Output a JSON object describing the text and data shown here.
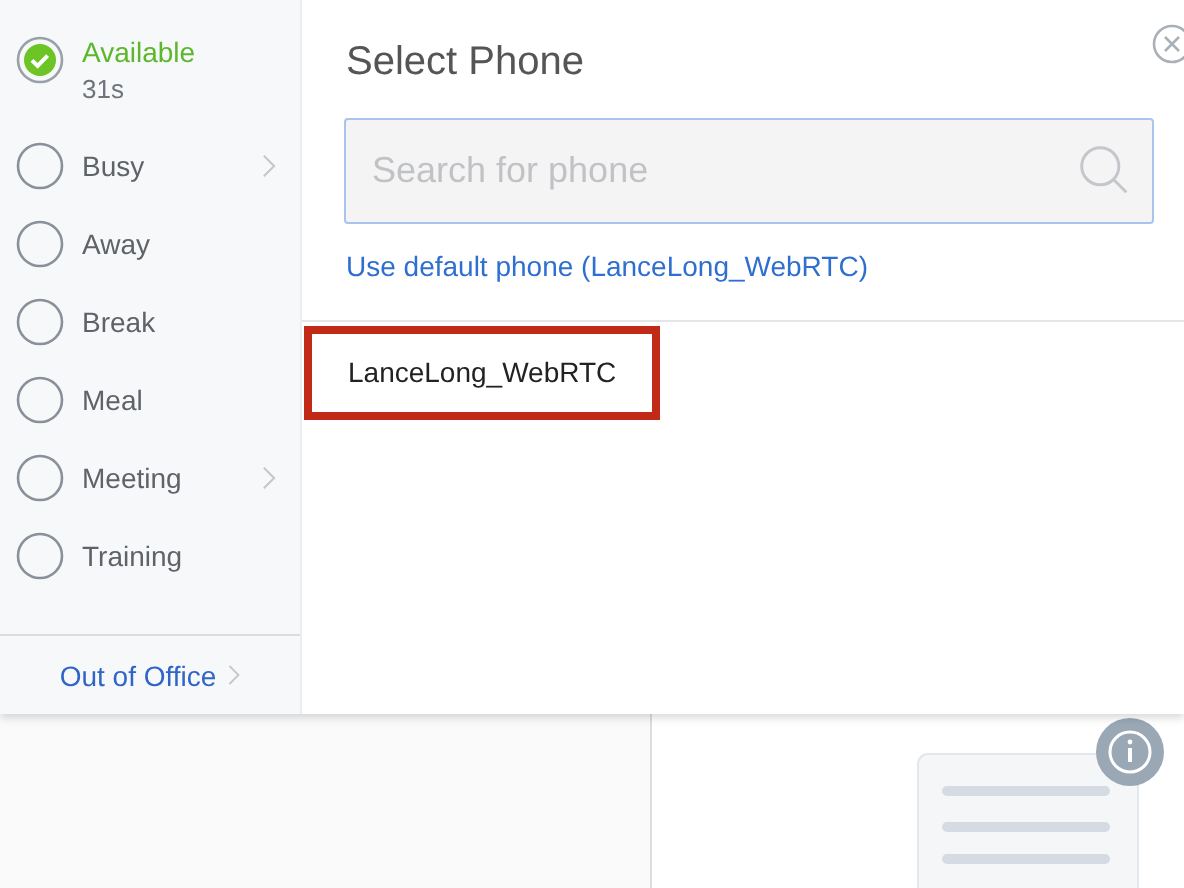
{
  "statuses": [
    {
      "label": "Available",
      "detail": "31s",
      "selected": true,
      "submenu": false
    },
    {
      "label": "Busy",
      "selected": false,
      "submenu": true
    },
    {
      "label": "Away",
      "selected": false,
      "submenu": false
    },
    {
      "label": "Break",
      "selected": false,
      "submenu": false
    },
    {
      "label": "Meal",
      "selected": false,
      "submenu": false
    },
    {
      "label": "Meeting",
      "selected": false,
      "submenu": true
    },
    {
      "label": "Training",
      "selected": false,
      "submenu": false
    }
  ],
  "out_of_office": {
    "label": "Out of Office"
  },
  "dialog": {
    "title": "Select Phone",
    "search": {
      "placeholder": "Search for phone"
    },
    "default_link": "Use default phone (LanceLong_WebRTC)",
    "phones": [
      {
        "name": "LanceLong_WebRTC",
        "highlighted": true
      }
    ]
  }
}
